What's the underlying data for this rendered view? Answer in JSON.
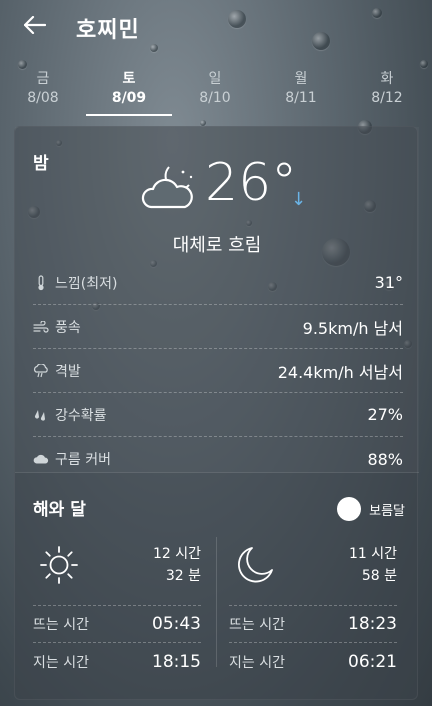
{
  "header": {
    "title": "호찌민",
    "back_icon": "arrow-left-icon"
  },
  "days": [
    {
      "name": "금",
      "date": "8/08"
    },
    {
      "name": "토",
      "date": "8/09"
    },
    {
      "name": "일",
      "date": "8/10"
    },
    {
      "name": "월",
      "date": "8/11"
    },
    {
      "name": "화",
      "date": "8/12"
    }
  ],
  "selected_day_index": 1,
  "forecast": {
    "period": "밤",
    "temperature": "26°",
    "trend_arrow": "↓",
    "condition": "대체로 흐림",
    "icon": "cloud-moon-icon",
    "details": [
      {
        "label": "느낌(최저)",
        "value": "31°",
        "icon": "thermometer-icon"
      },
      {
        "label": "풍속",
        "value": "9.5km/h 남서",
        "icon": "wind-icon"
      },
      {
        "label": "격발",
        "value": "24.4km/h 서남서",
        "icon": "gust-icon"
      },
      {
        "label": "강수확률",
        "value": "27%",
        "icon": "rain-drops-icon"
      },
      {
        "label": "구름 커버",
        "value": "88%",
        "icon": "cloud-icon"
      }
    ]
  },
  "sun_moon": {
    "title": "해와 달",
    "moon_phase": "보름달",
    "sun": {
      "hours": "12 시간",
      "minutes": "32 분",
      "rise_label": "뜨는 시간",
      "rise": "05:43",
      "set_label": "지는 시간",
      "set": "18:15"
    },
    "moon": {
      "hours": "11 시간",
      "minutes": "58 분",
      "rise_label": "뜨는 시간",
      "rise": "18:23",
      "set_label": "지는 시간",
      "set": "06:21"
    }
  },
  "colors": {
    "accent_arrow": "#6ab4e6",
    "text": "#ffffff"
  }
}
